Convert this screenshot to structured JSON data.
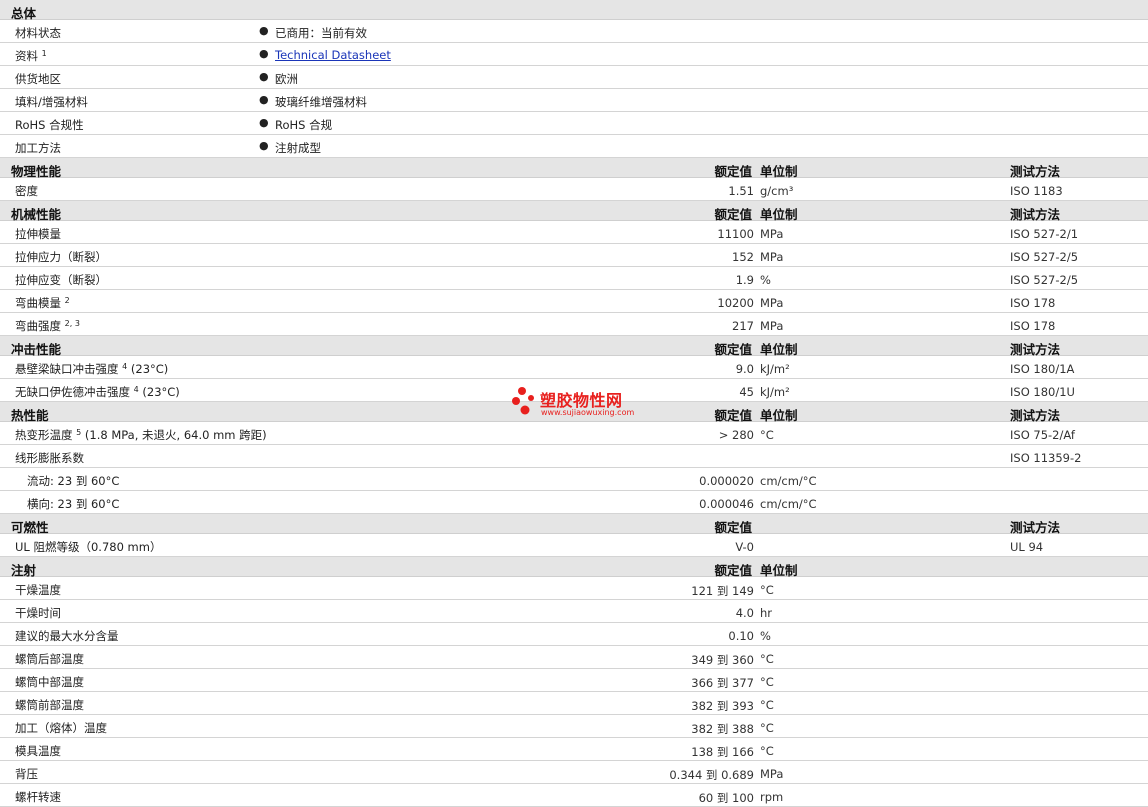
{
  "general": {
    "title": "总体",
    "rows": [
      {
        "label": "材料状态",
        "value": "已商用：当前有效",
        "link": false
      },
      {
        "label": "资料",
        "sup": "1",
        "value": "Technical Datasheet",
        "link": true
      },
      {
        "label": "供货地区",
        "value": "欧洲",
        "link": false
      },
      {
        "label": "填料/增强材料",
        "value": "玻璃纤维增强材料",
        "link": false
      },
      {
        "label": "RoHS 合规性",
        "value": "RoHS 合规",
        "link": false
      },
      {
        "label": "加工方法",
        "value": "注射成型",
        "link": false
      }
    ]
  },
  "bullet_char": "●",
  "sections": [
    {
      "title": "物理性能",
      "h_value": "额定值",
      "h_unit": "单位制",
      "h_test": "测试方法",
      "rows": [
        {
          "label": "密度",
          "value": "1.51",
          "unit": "g/cm³",
          "test": "ISO 1183"
        }
      ]
    },
    {
      "title": "机械性能",
      "h_value": "额定值",
      "h_unit": "单位制",
      "h_test": "测试方法",
      "rows": [
        {
          "label": "拉伸模量",
          "value": "11100",
          "unit": "MPa",
          "test": "ISO 527-2/1"
        },
        {
          "label": "拉伸应力（断裂）",
          "value": "152",
          "unit": "MPa",
          "test": "ISO 527-2/5"
        },
        {
          "label": "拉伸应变（断裂）",
          "value": "1.9",
          "unit": "%",
          "test": "ISO 527-2/5"
        },
        {
          "label": "弯曲模量",
          "sup": "2",
          "value": "10200",
          "unit": "MPa",
          "test": "ISO 178"
        },
        {
          "label": "弯曲强度",
          "sup": "2, 3",
          "value": "217",
          "unit": "MPa",
          "test": "ISO 178"
        }
      ]
    },
    {
      "title": "冲击性能",
      "h_value": "额定值",
      "h_unit": "单位制",
      "h_test": "测试方法",
      "rows": [
        {
          "label": "悬壁梁缺口冲击强度",
          "sup": "4",
          "suffix": " (23°C)",
          "value": "9.0",
          "unit": "kJ/m²",
          "test": "ISO 180/1A"
        },
        {
          "label": "无缺口伊佐德冲击强度",
          "sup": "4",
          "suffix": " (23°C)",
          "value": "45",
          "unit": "kJ/m²",
          "test": "ISO 180/1U"
        }
      ]
    },
    {
      "title": "热性能",
      "h_value": "额定值",
      "h_unit": "单位制",
      "h_test": "测试方法",
      "rows": [
        {
          "label": "热变形温度",
          "sup": "5",
          "suffix": " (1.8 MPa, 未退火, 64.0 mm 跨距)",
          "value": "> 280",
          "unit": "°C",
          "test": "ISO 75-2/Af"
        },
        {
          "label": "线形膨胀系数",
          "value": "",
          "unit": "",
          "test": "ISO 11359-2"
        },
        {
          "label": "流动: 23 到  60°C",
          "sub": true,
          "value": "0.000020",
          "unit": "cm/cm/°C",
          "test": ""
        },
        {
          "label": "横向: 23 到  60°C",
          "sub": true,
          "value": "0.000046",
          "unit": "cm/cm/°C",
          "test": ""
        }
      ]
    },
    {
      "title": "可燃性",
      "h_value": "额定值",
      "h_unit": "",
      "h_test": "测试方法",
      "rows": [
        {
          "label": "UL 阻燃等级（0.780 mm）",
          "value": "V-0",
          "unit": "",
          "test": "UL 94"
        }
      ]
    },
    {
      "title": "注射",
      "h_value": "额定值",
      "h_unit": "单位制",
      "h_test": "",
      "rows": [
        {
          "label": "干燥温度",
          "value": "121 到  149",
          "unit": "°C",
          "test": ""
        },
        {
          "label": "干燥时间",
          "value": "4.0",
          "unit": "hr",
          "test": ""
        },
        {
          "label": "建议的最大水分含量",
          "value": "0.10",
          "unit": "%",
          "test": ""
        },
        {
          "label": "螺筒后部温度",
          "value": "349 到  360",
          "unit": "°C",
          "test": ""
        },
        {
          "label": "螺筒中部温度",
          "value": "366 到  377",
          "unit": "°C",
          "test": ""
        },
        {
          "label": "螺筒前部温度",
          "value": "382 到  393",
          "unit": "°C",
          "test": ""
        },
        {
          "label": "加工（熔体）温度",
          "value": "382 到  388",
          "unit": "°C",
          "test": ""
        },
        {
          "label": "模具温度",
          "value": "138 到  166",
          "unit": "°C",
          "test": ""
        },
        {
          "label": "背压",
          "value": "0.344 到  0.689",
          "unit": "MPa",
          "test": ""
        },
        {
          "label": "螺杆转速",
          "value": "60 到  100",
          "unit": "rpm",
          "test": ""
        }
      ]
    }
  ],
  "watermark": {
    "title": "塑胶物性网",
    "url": "www.sujiaowuxing.com",
    "color": "#e8201e"
  }
}
